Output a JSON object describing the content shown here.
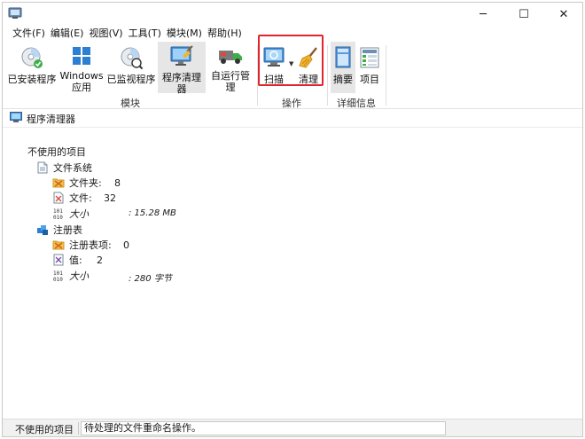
{
  "window": {
    "controls": {
      "minimize": "─",
      "maximize": "☐",
      "close": "✕"
    }
  },
  "menu": [
    "文件(F)",
    "编辑(E)",
    "视图(V)",
    "工具(T)",
    "模块(M)",
    "帮助(H)"
  ],
  "ribbon": {
    "modules": {
      "group_label": "模块",
      "buttons": [
        {
          "label": "已安装程序",
          "icon": "cd-install-icon"
        },
        {
          "label": "Windows\n应用",
          "icon": "windows-logo-icon"
        },
        {
          "label": "已监视程序",
          "icon": "cd-monitor-icon"
        },
        {
          "label": "程序清理器",
          "icon": "monitor-broom-icon",
          "active": true
        },
        {
          "label": "自运行管理",
          "icon": "truck-icon"
        }
      ]
    },
    "actions": {
      "group_label": "操作",
      "buttons": [
        {
          "label": "扫描",
          "icon": "scan-monitor-icon"
        },
        {
          "label": "清理",
          "icon": "broom-icon"
        }
      ],
      "dropdown": "▼"
    },
    "details": {
      "group_label": "详细信息",
      "buttons": [
        {
          "label": "摘要",
          "icon": "summary-icon",
          "active": true
        },
        {
          "label": "项目",
          "icon": "items-list-icon"
        }
      ]
    }
  },
  "section": {
    "title": "程序清理器"
  },
  "tree": {
    "root": "不使用的项目",
    "filesystem": {
      "label": "文件系统",
      "folders_label": "文件夹:",
      "folders_value": "8",
      "files_label": "文件:",
      "files_value": "32",
      "size_label": "大小",
      "size_value": ": 15.28 MB"
    },
    "registry": {
      "label": "注册表",
      "entries_label": "注册表项:",
      "entries_value": "0",
      "values_label": "值:",
      "values_value": "2",
      "size_label": "大小",
      "size_value": ": 280 字节"
    }
  },
  "status": {
    "left": "不使用的项目",
    "message": "待处理的文件重命名操作。"
  }
}
